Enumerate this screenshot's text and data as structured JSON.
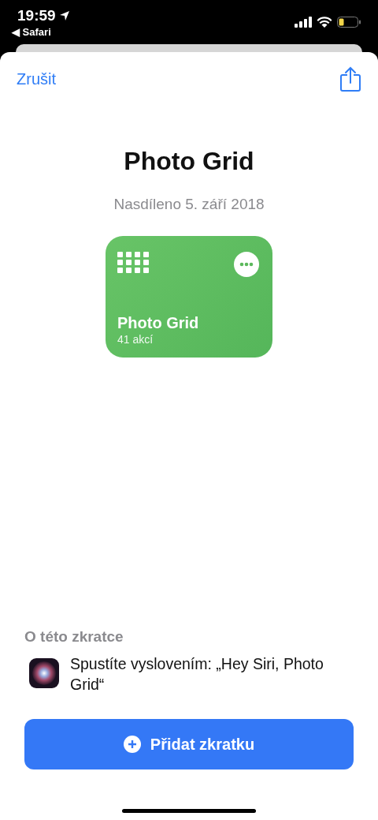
{
  "status_bar": {
    "time": "19:59",
    "back_app": "◀ Safari"
  },
  "nav": {
    "cancel": "Zrušit"
  },
  "title": "Photo Grid",
  "shared_date": "Nasdíleno 5. září 2018",
  "card": {
    "title": "Photo Grid",
    "subtitle": "41 akcí"
  },
  "about": {
    "heading": "O této zkratce",
    "siri_text": "Spustíte vyslovením: „Hey Siri, Photo Grid“"
  },
  "add_button": {
    "label": "Přidat zkratku"
  }
}
